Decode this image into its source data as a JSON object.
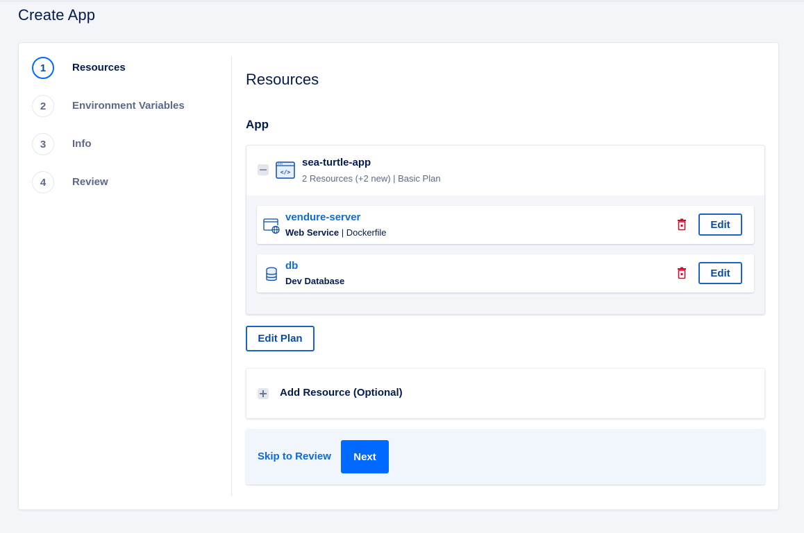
{
  "page": {
    "title": "Create App"
  },
  "steps": [
    {
      "number": "1",
      "label": "Resources",
      "active": true
    },
    {
      "number": "2",
      "label": "Environment Variables",
      "active": false
    },
    {
      "number": "3",
      "label": "Info",
      "active": false
    },
    {
      "number": "4",
      "label": "Review",
      "active": false
    }
  ],
  "main": {
    "section_title": "Resources",
    "app_subtitle": "App",
    "app": {
      "name": "sea-turtle-app",
      "meta": "2 Resources (+2 new) | Basic Plan",
      "icon": "code-window-icon",
      "resources": [
        {
          "name": "vendure-server",
          "type": "Web Service",
          "source": "Dockerfile",
          "icon": "web-service-globe-icon",
          "edit_label": "Edit"
        },
        {
          "name": "db",
          "type": "Dev Database",
          "source": "",
          "icon": "database-icon",
          "edit_label": "Edit"
        }
      ]
    },
    "edit_plan_label": "Edit Plan",
    "add_resource_label": "Add Resource (Optional)",
    "skip_label": "Skip to Review",
    "next_label": "Next"
  },
  "colors": {
    "primary": "#0069ff",
    "link": "#0b6bd8",
    "danger": "#c8102e",
    "text": "#031b4e",
    "muted": "#5b6987",
    "background": "#f3f5f9"
  }
}
